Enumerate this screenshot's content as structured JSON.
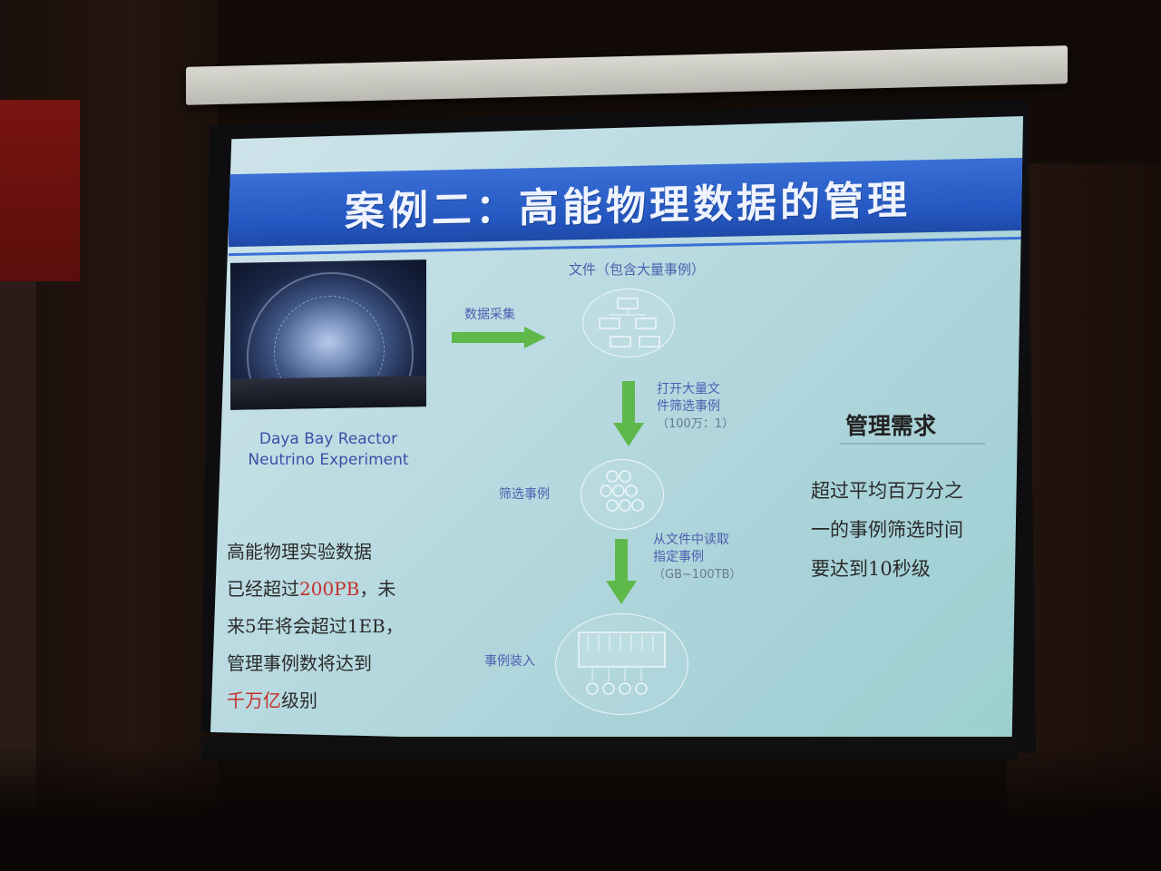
{
  "slide": {
    "title": "案例二：高能物理数据的管理",
    "photo_caption": [
      "Daya Bay Reactor",
      "Neutrino Experiment"
    ],
    "left_text": {
      "line1": "高能物理实验数据",
      "line2_prefix": "已经超过",
      "line2_red": "200PB",
      "line2_suffix": "，未",
      "line3": "来5年将会超过1EB，",
      "line4": "管理事例数将达到",
      "line5_red": "千万亿",
      "line5_suffix": "级别"
    },
    "flow": {
      "step_collect": "数据采集",
      "file_label": "文件（包含大量事例）",
      "step_open_1": "打开大量文",
      "step_open_2": "件筛选事例",
      "step_open_3": "（100万：1）",
      "filtered_label": "筛选事例",
      "step_read_1": "从文件中读取",
      "step_read_2": "指定事例",
      "step_read_3": "（GB~100TB）",
      "load_label": "事例装入"
    },
    "requirement": {
      "title": "管理需求",
      "line1": "超过平均百万分之",
      "line2": "一的事例筛选时间",
      "line3": "要达到10秒级"
    }
  },
  "colors": {
    "title_bar": "#2457c1",
    "arrow_green": "#5fb84a",
    "highlight_red": "#c4302b",
    "caption_blue": "#3c4fa8"
  }
}
